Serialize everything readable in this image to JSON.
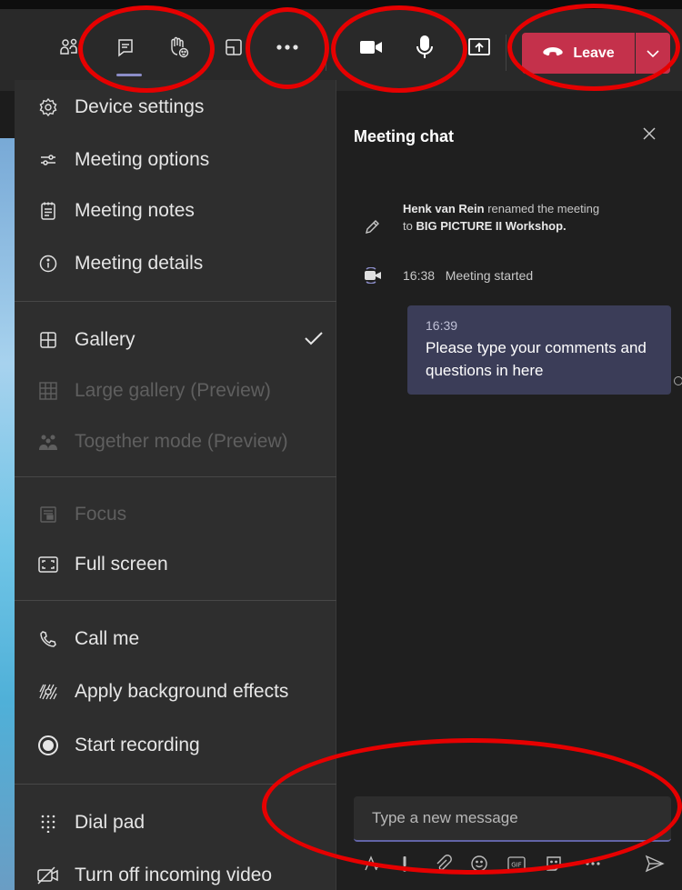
{
  "toolbar": {
    "leave_label": "Leave",
    "buttons": [
      "participants-icon",
      "chat-icon",
      "raise-hand-icon",
      "rooms-icon",
      "more-actions-icon",
      "camera-icon",
      "microphone-icon",
      "share-screen-icon"
    ]
  },
  "menu": {
    "items": [
      {
        "label": "Device settings",
        "icon": "gear-icon",
        "enabled": true
      },
      {
        "label": "Meeting options",
        "icon": "sliders-icon",
        "enabled": true
      },
      {
        "label": "Meeting notes",
        "icon": "notes-icon",
        "enabled": true
      },
      {
        "label": "Meeting details",
        "icon": "info-icon",
        "enabled": true
      },
      {
        "label": "Gallery",
        "icon": "gallery-icon",
        "enabled": true,
        "checked": true
      },
      {
        "label": "Large gallery (Preview)",
        "icon": "large-gallery-icon",
        "enabled": false
      },
      {
        "label": "Together mode (Preview)",
        "icon": "together-mode-icon",
        "enabled": false
      },
      {
        "label": "Focus",
        "icon": "focus-icon",
        "enabled": false
      },
      {
        "label": "Full screen",
        "icon": "fullscreen-icon",
        "enabled": true
      },
      {
        "label": "Call me",
        "icon": "phone-icon",
        "enabled": true
      },
      {
        "label": "Apply background effects",
        "icon": "background-effects-icon",
        "enabled": true
      },
      {
        "label": "Start recording",
        "icon": "record-icon",
        "enabled": true
      },
      {
        "label": "Dial pad",
        "icon": "dialpad-icon",
        "enabled": true
      },
      {
        "label": "Turn off incoming video",
        "icon": "video-off-icon",
        "enabled": true
      }
    ]
  },
  "chat": {
    "title": "Meeting chat",
    "rename_event": {
      "user": "Henk van Rein",
      "text_before": " renamed the meeting to ",
      "meeting_name": "BIG PICTURE II Workshop",
      "text_after": "."
    },
    "start_event": {
      "time": "16:38",
      "text": "Meeting started"
    },
    "message": {
      "time": "16:39",
      "text": "Please type your comments and questions in here"
    },
    "compose_placeholder": "Type a new message"
  },
  "colors": {
    "leave_button": "#c4314b",
    "accent": "#6264a7",
    "annotation_ring": "#e60000",
    "message_bubble": "#3b3d58"
  }
}
